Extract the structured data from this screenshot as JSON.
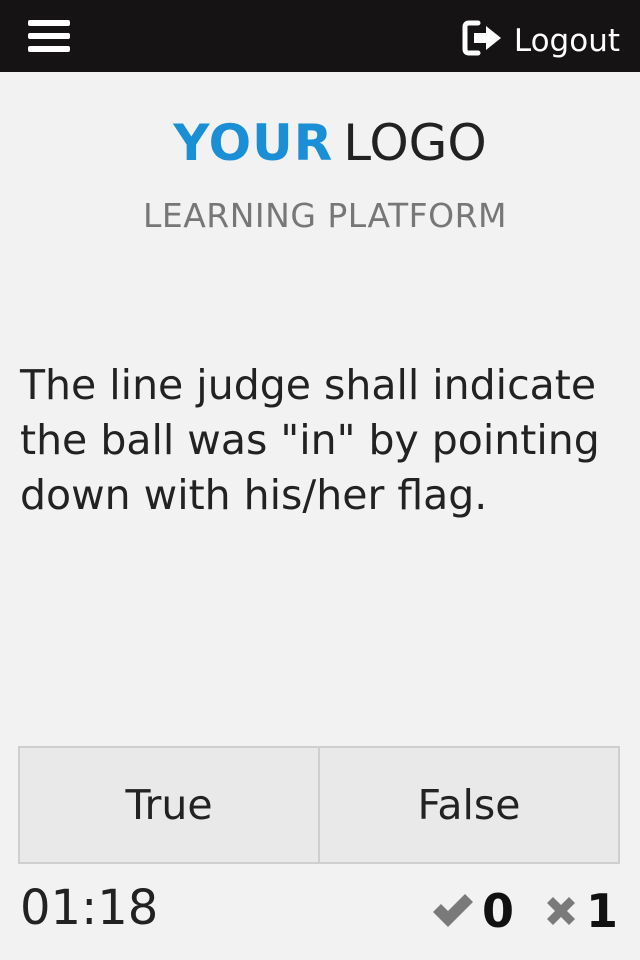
{
  "header": {
    "menu_icon": "hamburger-menu-icon",
    "logout_icon": "logout-arrow-icon",
    "logout_label": "Logout"
  },
  "branding": {
    "logo_bold": "YOUR",
    "logo_light": "LOGO",
    "subtitle": "LEARNING PLATFORM",
    "accent_color": "#1a8fd6"
  },
  "question": {
    "text": "The line judge shall indicate the ball was \"in\" by pointing down with his/her flag."
  },
  "answers": [
    {
      "label": "True"
    },
    {
      "label": "False"
    }
  ],
  "footer": {
    "timer": "01:18",
    "correct_count": "0",
    "wrong_count": "1",
    "correct_icon": "checkmark-icon",
    "wrong_icon": "cross-icon"
  }
}
